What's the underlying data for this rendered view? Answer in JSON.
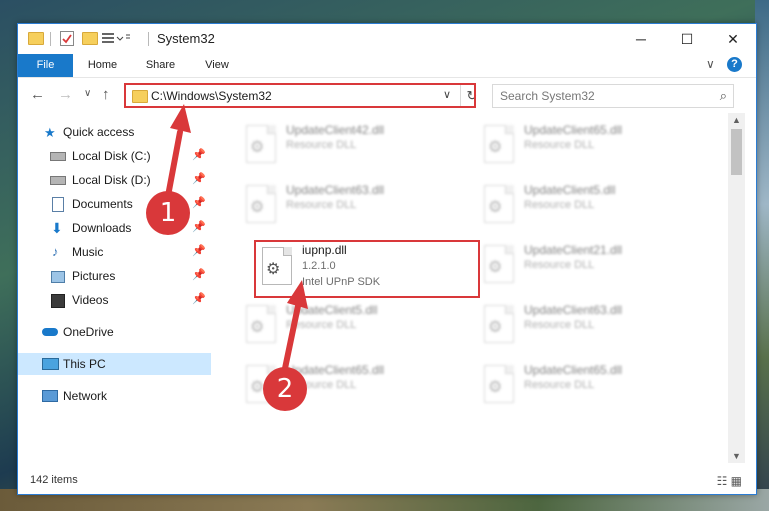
{
  "window": {
    "title": "System32",
    "controls": {
      "minimize": "─",
      "maximize": "☐",
      "close": "✕"
    }
  },
  "ribbon": {
    "tabs": [
      "File",
      "Home",
      "Share",
      "View"
    ],
    "expand": "∨",
    "help": "?"
  },
  "address_bar": {
    "path": "C:\\Windows\\System32",
    "search_placeholder": "Search System32"
  },
  "navigation": {
    "quick_access": "Quick access",
    "items": [
      {
        "label": "Local Disk (C:)",
        "pinned": true
      },
      {
        "label": "Local Disk (D:)",
        "pinned": true
      },
      {
        "label": "Documents",
        "pinned": true
      },
      {
        "label": "Downloads",
        "pinned": true
      },
      {
        "label": "Music",
        "pinned": true
      },
      {
        "label": "Pictures",
        "pinned": true
      },
      {
        "label": "Videos",
        "pinned": true
      }
    ],
    "onedrive": "OneDrive",
    "this_pc": "This PC",
    "network": "Network"
  },
  "files": {
    "focus": {
      "name": "iupnp.dll",
      "version": "1.2.1.0",
      "description": "Intel UPnP SDK"
    },
    "background": [
      {
        "name": "UpdateClient42.dll",
        "type": "Resource DLL"
      },
      {
        "name": "UpdateClient65.dll",
        "type": "Resource DLL"
      },
      {
        "name": "UpdateClient63.dll",
        "type": "Resource DLL"
      },
      {
        "name": "UpdateClient5.dll",
        "type": "Resource DLL"
      },
      {
        "name": "UpdateClient21.dll",
        "type": "Resource DLL"
      },
      {
        "name": "UpdateClient5.dll",
        "type": "Resource DLL"
      },
      {
        "name": "UpdateClient63.dll",
        "type": "Resource DLL"
      },
      {
        "name": "UpdateClient65.dll",
        "type": "Resource DLL"
      },
      {
        "name": "UpdateClient65.dll",
        "type": "Resource DLL"
      }
    ]
  },
  "status": {
    "item_count": "142 items"
  },
  "annotations": {
    "step1": "1",
    "step2": "2",
    "color": "#d9383a"
  }
}
